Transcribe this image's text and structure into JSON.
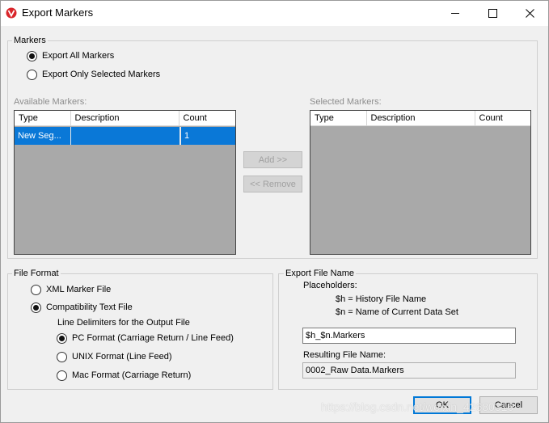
{
  "window": {
    "title": "Export Markers",
    "icon": "app-logo-icon",
    "controls": {
      "minimize": "minimize-icon",
      "maximize": "maximize-icon",
      "close": "close-icon"
    }
  },
  "markers": {
    "legend": "Markers",
    "options": [
      {
        "label": "Export All Markers",
        "checked": true
      },
      {
        "label": "Export Only Selected Markers",
        "checked": false
      }
    ],
    "available": {
      "label": "Available Markers:",
      "columns": [
        "Type",
        "Description",
        "Count"
      ],
      "rows": [
        {
          "type": "New Seg...",
          "description": "",
          "count": "1"
        }
      ]
    },
    "selected": {
      "label": "Selected Markers:",
      "columns": [
        "Type",
        "Description",
        "Count"
      ],
      "rows": []
    },
    "add_label": "Add >>",
    "remove_label": "<< Remove"
  },
  "file_format": {
    "legend": "File Format",
    "options": [
      {
        "label": "XML Marker File",
        "checked": false
      },
      {
        "label": "Compatibility Text File",
        "checked": true
      }
    ],
    "delimiters_label": "Line Delimiters for the Output File",
    "delimiters": [
      {
        "label": "PC Format (Carriage Return / Line Feed)",
        "checked": true
      },
      {
        "label": "UNIX Format (Line Feed)",
        "checked": false
      },
      {
        "label": "Mac Format (Carriage Return)",
        "checked": false
      }
    ]
  },
  "export_file_name": {
    "legend": "Export File Name",
    "placeholders_label": "Placeholders:",
    "placeholder_h": "$h = History File Name",
    "placeholder_n": "$n = Name of Current Data Set",
    "file_name_value": "$h_$n.Markers",
    "resulting_label": "Resulting File Name:",
    "resulting_value": "0002_Raw Data.Markers"
  },
  "buttons": {
    "ok": "OK",
    "cancel": "Cancel"
  },
  "watermark": "https://blog.csdn.net/weixin_42680316",
  "colors": {
    "selection": "#0a78d7",
    "list_bg": "#a9a9a9",
    "dialog_bg": "#f0f0f0"
  }
}
